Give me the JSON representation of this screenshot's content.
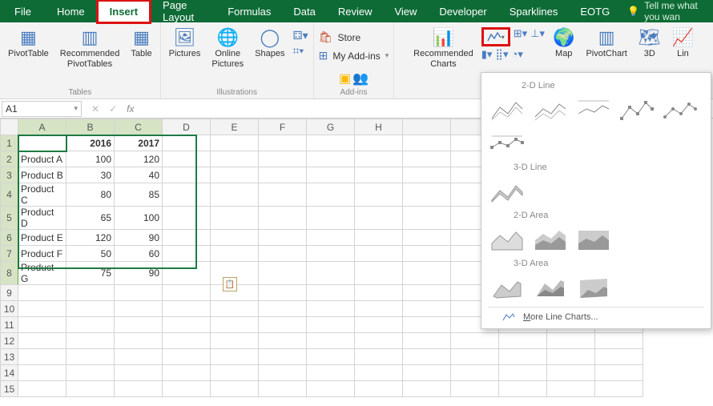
{
  "menu": {
    "file": "File",
    "home": "Home",
    "insert": "Insert",
    "page_layout": "Page Layout",
    "formulas": "Formulas",
    "data": "Data",
    "review": "Review",
    "view": "View",
    "developer": "Developer",
    "sparklines": "Sparklines",
    "eotg": "EOTG",
    "tell_me": "Tell me what you wan"
  },
  "ribbon": {
    "tables": {
      "label": "Tables",
      "pivottable": "PivotTable",
      "recommended": "Recommended\nPivotTables",
      "table": "Table"
    },
    "illustrations": {
      "label": "Illustrations",
      "pictures": "Pictures",
      "online": "Online\nPictures",
      "shapes": "Shapes"
    },
    "addins": {
      "label": "Add-ins",
      "store": "Store",
      "myaddins": "My Add-ins"
    },
    "charts": {
      "recommended": "Recommended\nCharts",
      "pivotchart": "PivotChart",
      "map": "Map",
      "three_d": "3D"
    }
  },
  "formula_bar": {
    "namebox": "A1",
    "fx": "fx"
  },
  "columns": [
    "A",
    "B",
    "C",
    "D",
    "E",
    "F",
    "G",
    "H"
  ],
  "rows": [
    "1",
    "2",
    "3",
    "4",
    "5",
    "6",
    "7",
    "8",
    "9",
    "10",
    "11",
    "12",
    "13",
    "14",
    "15"
  ],
  "headers": {
    "b": "2016",
    "c": "2017"
  },
  "table": [
    {
      "name": "Product A",
      "y2016": "100",
      "y2017": "120"
    },
    {
      "name": "Product B",
      "y2016": "30",
      "y2017": "40"
    },
    {
      "name": "Product C",
      "y2016": "80",
      "y2017": "85"
    },
    {
      "name": "Product D",
      "y2016": "65",
      "y2017": "100"
    },
    {
      "name": "Product E",
      "y2016": "120",
      "y2017": "90"
    },
    {
      "name": "Product F",
      "y2016": "50",
      "y2017": "60"
    },
    {
      "name": "Product G",
      "y2016": "75",
      "y2017": "90"
    }
  ],
  "chart_popup": {
    "line2d": "2-D Line",
    "line3d": "3-D Line",
    "area2d": "2-D Area",
    "area3d": "3-D Area",
    "more": "More Line Charts...",
    "more_key": "M"
  },
  "chart_data": {
    "type": "table",
    "title": "",
    "columns": [
      "",
      "2016",
      "2017"
    ],
    "rows": [
      [
        "Product A",
        100,
        120
      ],
      [
        "Product B",
        30,
        40
      ],
      [
        "Product C",
        80,
        85
      ],
      [
        "Product D",
        65,
        100
      ],
      [
        "Product E",
        120,
        90
      ],
      [
        "Product F",
        50,
        60
      ],
      [
        "Product G",
        75,
        90
      ]
    ]
  }
}
